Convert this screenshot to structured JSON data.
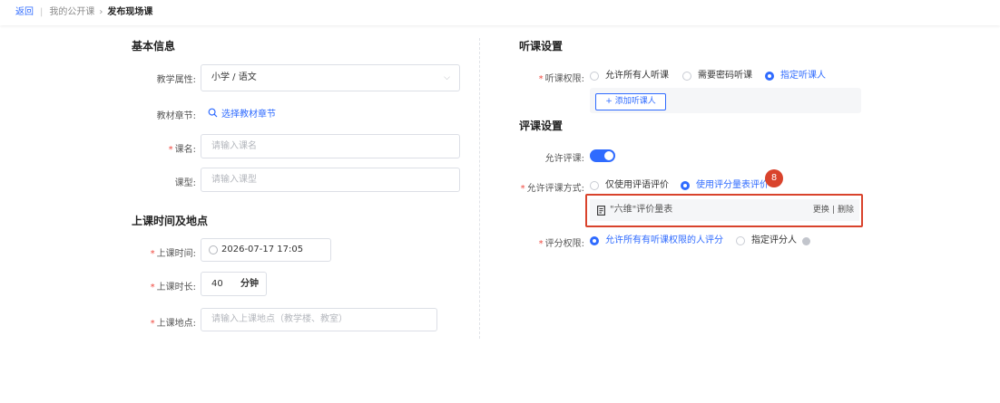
{
  "breadcrumb": {
    "back": "返回",
    "parent": "我的公开课",
    "current": "发布现场课"
  },
  "basic": {
    "title": "基本信息",
    "subject_label": "教学属性:",
    "subject_value": "小学 / 语文",
    "chapter_label": "教材章节:",
    "chapter_link": "选择教材章节",
    "name_label": "课名:",
    "name_placeholder": "请输入课名",
    "type_label": "课型:",
    "type_placeholder": "请输入课型"
  },
  "schedule": {
    "title": "上课时间及地点",
    "time_label": "上课时间:",
    "time_value": "2026-07-17 17:05",
    "duration_label": "上课时长:",
    "duration_value": "40",
    "duration_unit": "分钟",
    "place_label": "上课地点:",
    "place_placeholder": "请输入上课地点（教学楼、教室）"
  },
  "listen": {
    "title": "听课设置",
    "perm_label": "听课权限:",
    "options": [
      "允许所有人听课",
      "需要密码听课",
      "指定听课人"
    ],
    "add_button": "+ 添加听课人"
  },
  "review": {
    "title": "评课设置",
    "allow_label": "允许评课:",
    "allow_on": true,
    "mode_label": "允许评课方式:",
    "mode_options": [
      "仅使用评语评价",
      "使用评分量表评价"
    ],
    "scale_name": "\"六维\"评价量表",
    "scale_change": "更换",
    "scale_sep": "|",
    "scale_delete": "删除",
    "score_label": "评分权限:",
    "score_options": [
      "允许所有有听课权限的人评分",
      "指定评分人"
    ],
    "annotation_number": "8"
  },
  "colors": {
    "accent": "#2f6bff",
    "required": "#f0483e",
    "highlight": "#d9432c"
  }
}
